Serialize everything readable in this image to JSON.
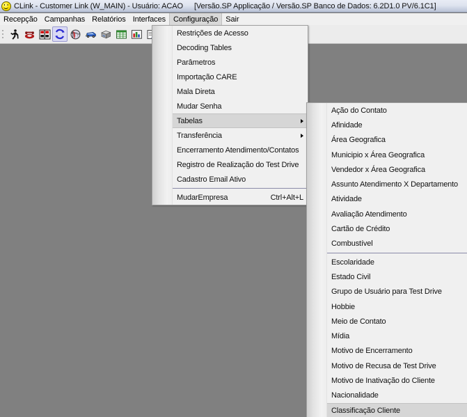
{
  "window": {
    "icon": "smiley-face-icon",
    "title": "CLink - Customer Link (W_MAIN) - Usuário: ACAO",
    "version_info": "[Versão.SP Applicação / Versão.SP Banco de Dados: 6.2D1.0 PV/6.1C1]"
  },
  "menubar": {
    "items": [
      {
        "label": "Recepção",
        "active": false
      },
      {
        "label": "Campanhas",
        "active": false
      },
      {
        "label": "Relatórios",
        "active": false
      },
      {
        "label": "Interfaces",
        "active": false
      },
      {
        "label": "Configuração",
        "active": true
      },
      {
        "label": "Sair",
        "active": false
      }
    ]
  },
  "toolbar": {
    "buttons": [
      {
        "name": "running-man-icon",
        "selected": false
      },
      {
        "name": "telephone-icon",
        "selected": false
      },
      {
        "name": "switchboard-icon",
        "selected": false
      },
      {
        "name": "refresh-cycle-icon",
        "selected": true
      },
      {
        "name": "globe-icon",
        "selected": false
      },
      {
        "name": "car-icon",
        "selected": false
      },
      {
        "name": "boxes-icon",
        "selected": false
      },
      {
        "name": "grid-table-icon",
        "selected": false
      },
      {
        "name": "bar-chart-icon",
        "selected": false
      },
      {
        "name": "edit-report-icon",
        "selected": false
      }
    ]
  },
  "config_menu": {
    "items": [
      {
        "label": "Restrições de Acesso",
        "type": "item"
      },
      {
        "label": "Decoding Tables",
        "type": "item"
      },
      {
        "label": "Parâmetros",
        "type": "item"
      },
      {
        "label": "Importação CARE",
        "type": "item"
      },
      {
        "label": "Mala Direta",
        "type": "item"
      },
      {
        "label": "Mudar Senha",
        "type": "item"
      },
      {
        "label": "Tabelas",
        "type": "submenu",
        "highlighted": true
      },
      {
        "label": "Transferência",
        "type": "submenu"
      },
      {
        "label": "Encerramento Atendimento/Contatos",
        "type": "item"
      },
      {
        "label": "Registro de Realização do Test Drive",
        "type": "item"
      },
      {
        "label": "Cadastro Email Ativo",
        "type": "item"
      },
      {
        "type": "separator"
      },
      {
        "label": "MudarEmpresa",
        "type": "item",
        "accel": "Ctrl+Alt+L"
      }
    ]
  },
  "tabelas_menu": {
    "items": [
      {
        "label": "Ação do Contato",
        "type": "item"
      },
      {
        "label": "Afinidade",
        "type": "item"
      },
      {
        "label": "Área Geografica",
        "type": "item"
      },
      {
        "label": "Municipio x Área Geografica",
        "type": "item"
      },
      {
        "label": "Vendedor x Área Geografica",
        "type": "item"
      },
      {
        "label": "Assunto Atendimento X Departamento",
        "type": "item"
      },
      {
        "label": "Atividade",
        "type": "item"
      },
      {
        "label": "Avaliação Atendimento",
        "type": "item"
      },
      {
        "label": "Cartão de Crédito",
        "type": "item"
      },
      {
        "label": "Combustível",
        "type": "item"
      },
      {
        "type": "separator"
      },
      {
        "label": "Escolaridade",
        "type": "item"
      },
      {
        "label": "Estado Civil",
        "type": "item"
      },
      {
        "label": "Grupo de Usuário para Test Drive",
        "type": "item"
      },
      {
        "label": "Hobbie",
        "type": "item"
      },
      {
        "label": "Meio de Contato",
        "type": "item"
      },
      {
        "label": "Mídia",
        "type": "item"
      },
      {
        "label": "Motivo de Encerramento",
        "type": "item"
      },
      {
        "label": "Motivo de Recusa de Test Drive",
        "type": "item"
      },
      {
        "label": "Motivo de Inativação do Cliente",
        "type": "item"
      },
      {
        "label": "Nacionalidade",
        "type": "item"
      },
      {
        "label": "Classificação Cliente",
        "type": "item",
        "highlighted": true
      }
    ]
  },
  "colors": {
    "workspace_bg": "#808080",
    "menu_bg": "#f0f0f0",
    "highlight_bg": "#d6d6d6",
    "titlebar_top": "#e8ecf5",
    "titlebar_bottom": "#b9c2d6",
    "separator": "#8a8aa8",
    "accent_selected_toolbar": "#9a9ad0"
  }
}
